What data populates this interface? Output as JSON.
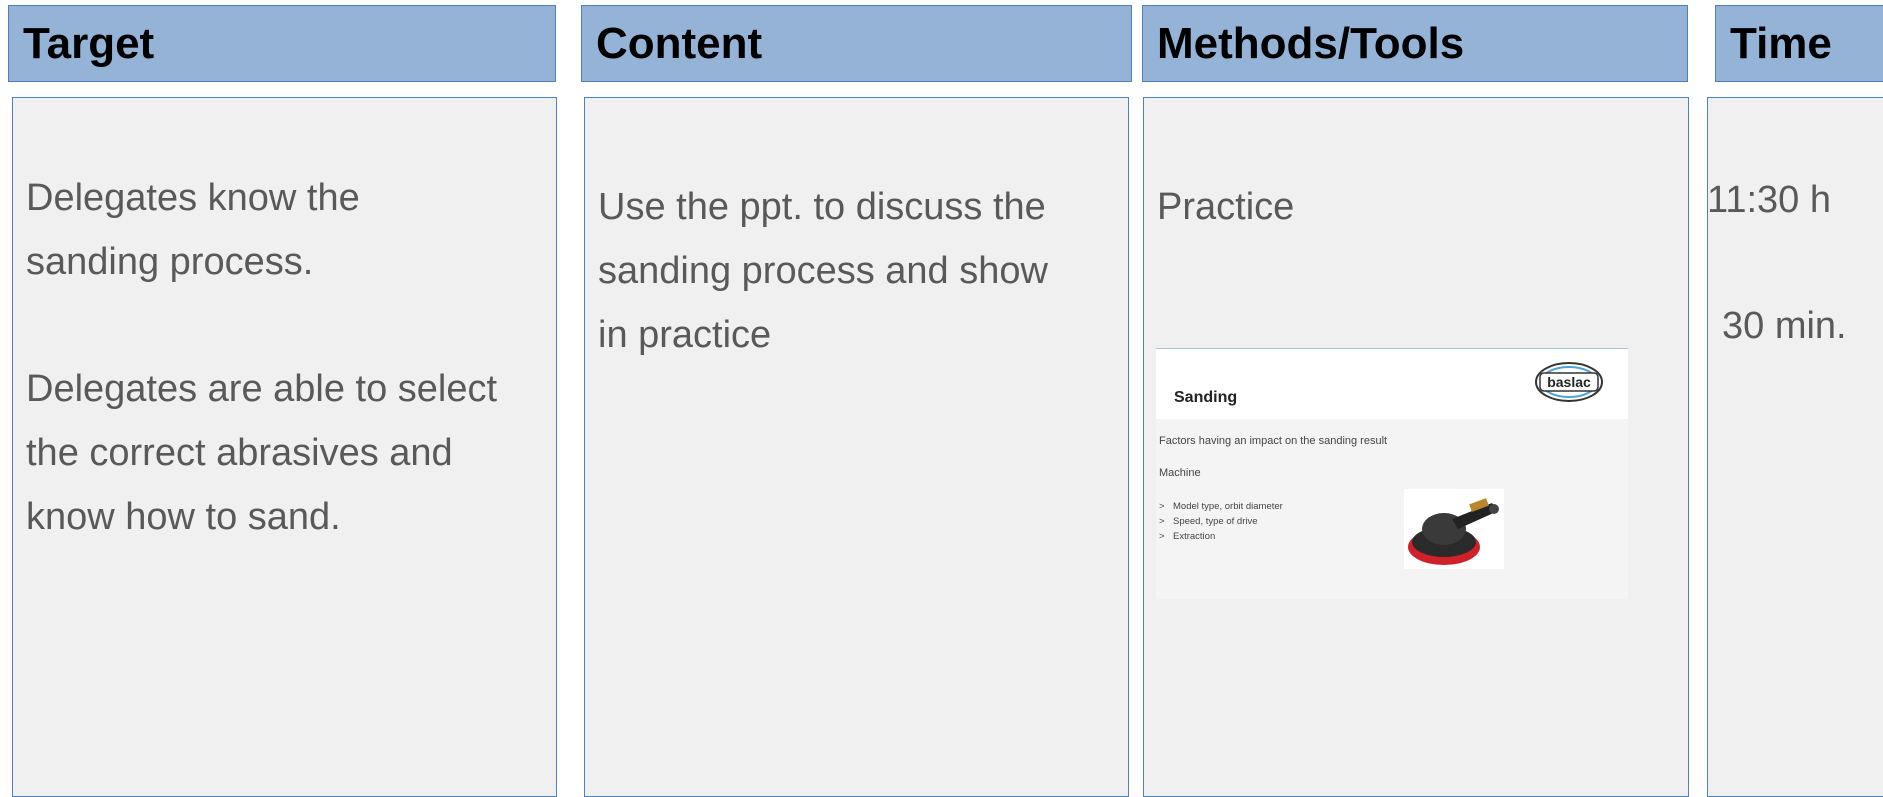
{
  "headers": {
    "target": "Target",
    "content": "Content",
    "methods": "Methods/Tools",
    "time": "Time"
  },
  "target": {
    "para1_line1": "Delegates know the",
    "para1_line2": "sanding process.",
    "para2_line1": "Delegates are able to select",
    "para2_line2": "the correct abrasives and",
    "para2_line3": "know how to sand."
  },
  "content": {
    "line1": "Use the ppt. to discuss the",
    "line2": "sanding process and show",
    "line3": "in practice"
  },
  "methods": {
    "label": "Practice",
    "slide": {
      "title": "Sanding",
      "logo_text": "baslac",
      "subtitle": "Factors having an impact on the sanding result",
      "section": "Machine",
      "bullets": [
        "Model type, orbit diameter",
        "Speed, type of drive",
        "Extraction"
      ],
      "bullet_glyph": ">",
      "image_icon": "orbital-sander-icon"
    }
  },
  "time": {
    "clock": "11:30 h",
    "duration": "30 min."
  },
  "colors": {
    "header_fill": "#95b3d7",
    "border": "#4f81bd",
    "body_fill": "#f0f0f0",
    "text": "#595959"
  }
}
